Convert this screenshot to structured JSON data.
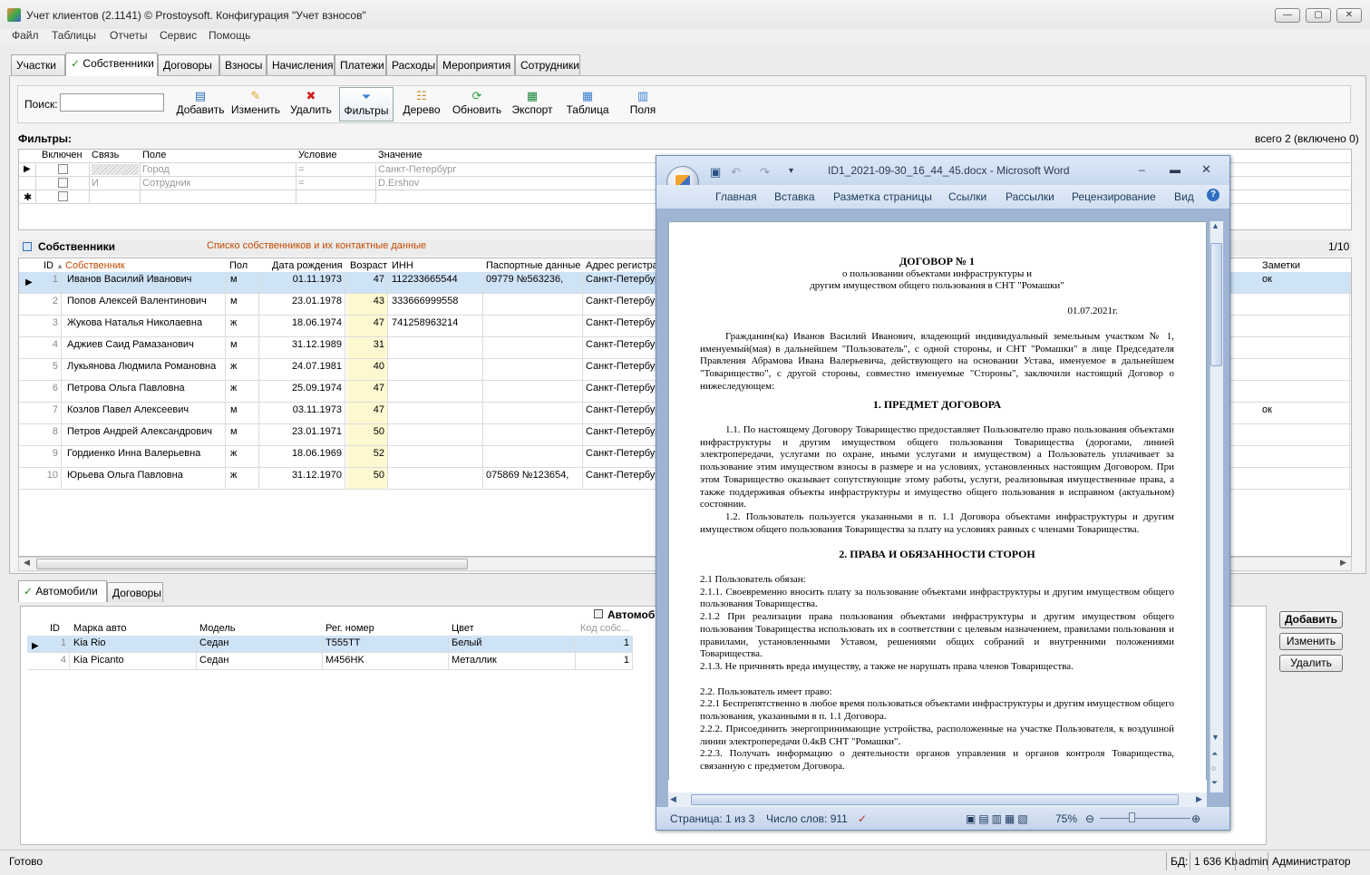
{
  "window": {
    "title": "Учет клиентов (2.1141) © Prostoysoft. Конфигурация \"Учет взносов\"",
    "min": "—",
    "max": "▢",
    "close": "✕"
  },
  "menu": [
    "Файл",
    "Таблицы",
    "Отчеты",
    "Сервис",
    "Помощь"
  ],
  "tabs": [
    "Участки",
    "Собственники",
    "Договоры",
    "Взносы",
    "Начисления",
    "Платежи",
    "Расходы",
    "Мероприятия",
    "Сотрудники"
  ],
  "toolbar": {
    "search_label": "Поиск:",
    "search_value": "",
    "buttons": [
      "Добавить",
      "Изменить",
      "Удалить",
      "Фильтры",
      "Дерево",
      "Обновить",
      "Экспорт",
      "Таблица",
      "Поля"
    ]
  },
  "filters": {
    "title": "Фильтры:",
    "count": "всего 2 (включено 0)",
    "columns": [
      "Включен",
      "Связь",
      "Поле",
      "Условие",
      "Значение"
    ],
    "rows": [
      {
        "link": "",
        "field": "Город",
        "cond": "=",
        "value": "Санкт-Петербург"
      },
      {
        "link": "И",
        "field": "Сотрудник",
        "cond": "=",
        "value": "D.Ershov"
      }
    ],
    "new_row_marker": "✱"
  },
  "owners": {
    "title": "Собственники",
    "subtitle": "Списко собственников и их контактные данные",
    "page": "1/10",
    "columns": {
      "id": "ID",
      "name": "Собственник",
      "sex": "Пол",
      "dob": "Дата рождения",
      "age": "Возраст",
      "inn": "ИНН",
      "passport": "Паспортные данные",
      "address": "Адрес регистра",
      "notes": "Заметки"
    },
    "rows": [
      {
        "id": "1",
        "name": "Иванов Василий Иванович",
        "sex": "м",
        "dob": "01.11.1973",
        "age": "47",
        "inn": "112233665544",
        "passport": "09779 №563236,",
        "address": "Санкт-Петербур",
        "notes": "ок"
      },
      {
        "id": "2",
        "name": "Попов Алексей Валентинович",
        "sex": "м",
        "dob": "23.01.1978",
        "age": "43",
        "inn": "333666999558",
        "passport": "",
        "address": "Санкт-Петербур",
        "notes": ""
      },
      {
        "id": "3",
        "name": "Жукова Наталья Николаевна",
        "sex": "ж",
        "dob": "18.06.1974",
        "age": "47",
        "inn": "741258963214",
        "passport": "",
        "address": "Санкт-Петербур",
        "notes": ""
      },
      {
        "id": "4",
        "name": "Аджиев Саид Рамазанович",
        "sex": "м",
        "dob": "31.12.1989",
        "age": "31",
        "inn": "",
        "passport": "",
        "address": "Санкт-Петербур",
        "notes": ""
      },
      {
        "id": "5",
        "name": "Лукьянова Людмила Романовна",
        "sex": "ж",
        "dob": "24.07.1981",
        "age": "40",
        "inn": "",
        "passport": "",
        "address": "Санкт-Петербур",
        "notes": ""
      },
      {
        "id": "6",
        "name": "Петрова Ольга Павловна",
        "sex": "ж",
        "dob": "25.09.1974",
        "age": "47",
        "inn": "",
        "passport": "",
        "address": "Санкт-Петербур",
        "notes": ""
      },
      {
        "id": "7",
        "name": "Козлов Павел Алексеевич",
        "sex": "м",
        "dob": "03.11.1973",
        "age": "47",
        "inn": "",
        "passport": "",
        "address": "Санкт-Петербур",
        "notes": "ок"
      },
      {
        "id": "8",
        "name": "Петров Андрей Александрович",
        "sex": "м",
        "dob": "23.01.1971",
        "age": "50",
        "inn": "",
        "passport": "",
        "address": "Санкт-Петербур",
        "notes": ""
      },
      {
        "id": "9",
        "name": "Гордиенко Инна Валерьевна",
        "sex": "ж",
        "dob": "18.06.1969",
        "age": "52",
        "inn": "",
        "passport": "",
        "address": "Санкт-Петербур",
        "notes": ""
      },
      {
        "id": "10",
        "name": "Юрьева Ольга Павловна",
        "sex": "ж",
        "dob": "31.12.1970",
        "age": "50",
        "inn": "",
        "passport": "075869 №123654,",
        "address": "Санкт-Петербур",
        "notes": ""
      }
    ]
  },
  "bottom_tabs": [
    "Автомобили",
    "Договоры"
  ],
  "cars": {
    "title": "Автомоб",
    "columns": {
      "id": "ID",
      "brand": "Марка авто",
      "model": "Модель",
      "reg": "Рег. номер",
      "color": "Цвет",
      "owner": "Код собс..."
    },
    "rows": [
      {
        "id": "1",
        "brand": "Kia Rio",
        "model": "Седан",
        "reg": "T555TT",
        "color": "Белый",
        "owner": "1"
      },
      {
        "id": "4",
        "brand": "Kia Picanto",
        "model": "Седан",
        "reg": "M456HK",
        "color": "Металлик",
        "owner": "1"
      }
    ],
    "buttons": {
      "add": "Добавить",
      "edit": "Изменить",
      "delete": "Удалить"
    }
  },
  "status": {
    "ready": "Готово",
    "db": "БД:",
    "size": "1 636 Kb",
    "user": "admin",
    "role": "Администратор"
  },
  "word": {
    "title": "ID1_2021-09-30_16_44_45.docx - Microsoft Word",
    "ribbon_tabs": [
      "Главная",
      "Вставка",
      "Разметка страницы",
      "Ссылки",
      "Рассылки",
      "Рецензирование",
      "Вид"
    ],
    "status_page": "Страница: 1 из 3",
    "status_words": "Число слов: 911",
    "zoom": "75%",
    "doc": {
      "title": "ДОГОВОР № 1",
      "subtitle1": "о пользовании объектами инфраструктуры и",
      "subtitle2": "другим имуществом общего пользования в СНТ \"Ромашки\"",
      "date": "01.07.2021г.",
      "intro": "Гражданин(ка) Иванов Василий Иванович, владеющий индивидуальный земельным участком № 1, именуемый(мая) в дальнейшем \"Пользователь\", с одной стороны, и СНТ \"Ромашки\" в лице Председателя Правления Абрамова Ивана Валерьевича, действующего на основании Устава, именуемое в дальнейшем \"Товарищество\", с другой стороны, совместно именуемые \"Стороны\", заключили настоящий Договор о нижеследующем:",
      "h1": "1. ПРЕДМЕТ ДОГОВОРА",
      "p11": "1.1. По настоящему Договору Товарищество предоставляет Пользователю право пользования объектами инфраструктуры и другим имуществом общего пользования Товарищества (дорогами, линией электропередачи, услугами по охране, иными услугами и имуществом) а Пользователь уплачивает за пользование этим имуществом взносы в размере и на условиях, установленных настоящим Договором. При этом Товарищество оказывает сопутствующие этому работы, услуги, реализовывая имущественные права, а также поддерживая объекты инфраструктуры и имущество общего пользования в исправном (актуальном) состоянии.",
      "p12": "1.2. Пользователь пользуется указанными в п. 1.1 Договора объектами инфраструктуры и другим имуществом общего пользования Товарищества за плату на условиях равных с членами Товарищества.",
      "h2": "2. ПРАВА И ОБЯЗАННОСТИ СТОРОН",
      "p21": "2.1 Пользователь обязан:",
      "p211": "2.1.1. Своевременно вносить плату за пользование объектами инфраструктуры и другим имуществом общего пользования Товарищества.",
      "p212": "2.1.2 При реализации права пользования объектами инфраструктуры и другим имуществом общего пользования Товарищества использовать их в соответствии с целевым назначением, правилами пользования и правилами, установленными Уставом, решениями общих собраний и внутренними положениями Товарищества.",
      "p213": "2.1.3. Не причинять вреда имуществу, а также не нарушать права членов Товарищества.",
      "p22": "2.2. Пользователь имеет право:",
      "p221": "2.2.1 Беспрепятственно в любое время пользоваться объектами инфраструктуры и другим имуществом общего пользования, указанными в п. 1.1 Договора.",
      "p222": "2.2.2. Присоединить энергопринимающие устройства, расположенные на участке Пользователя, к воздушной линии электропередачи 0.4кВ СНТ \"Ромашки\".",
      "p223": "2.2.3. Получать информацию о деятельности органов управления и органов контроля Товарищества, связанную с предметом Договора."
    }
  }
}
